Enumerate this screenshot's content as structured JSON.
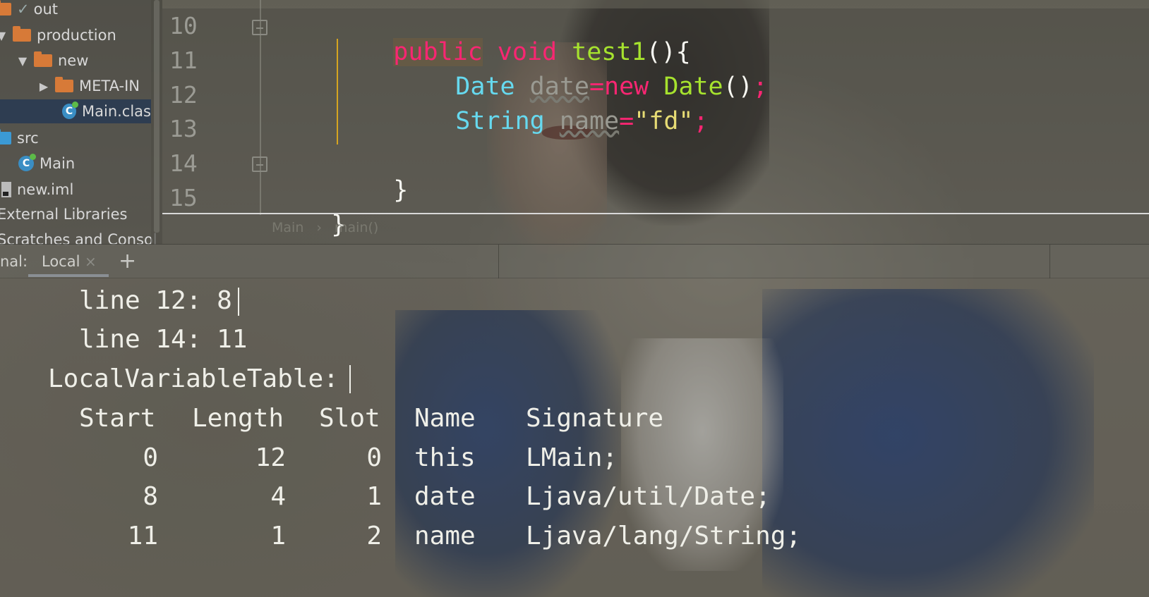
{
  "project_tree": {
    "items": [
      {
        "label": "out"
      },
      {
        "label": "production"
      },
      {
        "label": "new"
      },
      {
        "label": "META-IN"
      },
      {
        "label": "Main.clas"
      },
      {
        "label": "src"
      },
      {
        "label": "Main"
      },
      {
        "label": "new.iml"
      },
      {
        "label": "External Libraries"
      },
      {
        "label": "Scratches and Consol"
      }
    ]
  },
  "editor": {
    "line_numbers": [
      "10",
      "11",
      "12",
      "13",
      "14",
      "15"
    ],
    "lines": {
      "l10": {
        "kw1": "public",
        "kw2": " void",
        "fn": " test1",
        "rest": "(){"
      },
      "l11": {
        "type": "Date",
        "var": "date",
        "op": "=new",
        "fn": " Date",
        "paren": "()",
        "semi": ";"
      },
      "l12": {
        "type": "String",
        "var": "name",
        "op": "=",
        "str": "\"fd\"",
        "semi": ";"
      },
      "l14": {
        "brace": "}"
      },
      "l15": {
        "brace": "}"
      }
    },
    "breadcrumbs": [
      "Main",
      "›",
      "main()"
    ]
  },
  "terminal_bar": {
    "label": "nal:",
    "tab_label": "Local",
    "close": "×",
    "add": "+"
  },
  "terminal": {
    "lines": [
      "line 12: 8",
      "line 14: 11",
      "LocalVariableTable:"
    ],
    "table": {
      "headers": [
        "Start",
        "Length",
        "Slot",
        "Name",
        "Signature"
      ],
      "rows": [
        [
          "0",
          "12",
          "0",
          "this",
          "LMain;"
        ],
        [
          "8",
          "4",
          "1",
          "date",
          "Ljava/util/Date;"
        ],
        [
          "11",
          "1",
          "2",
          "name",
          "Ljava/lang/String;"
        ]
      ]
    }
  }
}
